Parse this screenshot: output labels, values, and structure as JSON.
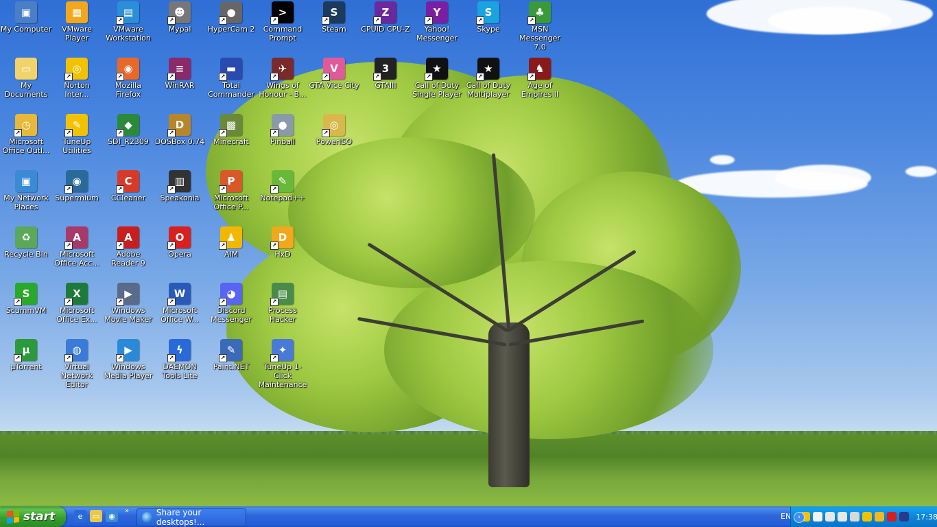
{
  "desktop": {
    "icons": [
      {
        "label": "My Computer",
        "icon": "computer-icon",
        "color": "#4a7fc6",
        "glyph": "▣"
      },
      {
        "label": "VMware Player",
        "icon": "vmware-icon",
        "color": "#f2a71c",
        "glyph": "▦"
      },
      {
        "label": "VMware Workstation",
        "icon": "vmware-workstation-icon",
        "color": "#2a8fd6",
        "glyph": "▤"
      },
      {
        "label": "Mypal",
        "icon": "mypal-icon",
        "color": "#777777",
        "glyph": "☻"
      },
      {
        "label": "HyperCam 2",
        "icon": "hypercam-icon",
        "color": "#666666",
        "glyph": "●"
      },
      {
        "label": "Command Prompt",
        "icon": "cmd-icon",
        "color": "#000000",
        "glyph": ">"
      },
      {
        "label": "Steam",
        "icon": "steam-icon",
        "color": "#1b3a5c",
        "glyph": "S"
      },
      {
        "label": "CPUID CPU-Z",
        "icon": "cpuz-icon",
        "color": "#6a2a9e",
        "glyph": "Z"
      },
      {
        "label": "Yahoo! Messenger",
        "icon": "yahoo-icon",
        "color": "#7a1fa2",
        "glyph": "Y"
      },
      {
        "label": "Skype",
        "icon": "skype-icon",
        "color": "#1aa3e0",
        "glyph": "S"
      },
      {
        "label": "MSN Messenger 7.0",
        "icon": "msn-icon",
        "color": "#3a9a3a",
        "glyph": "♣"
      },
      {
        "label": "My Documents",
        "icon": "documents-icon",
        "color": "#f2d36a",
        "glyph": "▭"
      },
      {
        "label": "Norton Inter...",
        "icon": "norton-icon",
        "color": "#f2c200",
        "glyph": "◎"
      },
      {
        "label": "Mozilla Firefox",
        "icon": "firefox-icon",
        "color": "#e8682a",
        "glyph": "◉"
      },
      {
        "label": "WinRAR",
        "icon": "winrar-icon",
        "color": "#8a2a6a",
        "glyph": "≡"
      },
      {
        "label": "Total Commander",
        "icon": "total-commander-icon",
        "color": "#2a4ab0",
        "glyph": "▬"
      },
      {
        "label": "Wings of Honour - B...",
        "icon": "wings-of-honour-icon",
        "color": "#7a2a2a",
        "glyph": "✈"
      },
      {
        "label": "GTA Vice City",
        "icon": "gta-vice-city-icon",
        "color": "#e05a9a",
        "glyph": "V"
      },
      {
        "label": "GTAIII",
        "icon": "gta3-icon",
        "color": "#222222",
        "glyph": "3"
      },
      {
        "label": "Call of Duty Single Player",
        "icon": "cod-sp-icon",
        "color": "#111111",
        "glyph": "★"
      },
      {
        "label": "Call of Duty Multiplayer",
        "icon": "cod-mp-icon",
        "color": "#111111",
        "glyph": "★"
      },
      {
        "label": "Age of Empires II",
        "icon": "aoe2-icon",
        "color": "#8a1a1a",
        "glyph": "♞"
      },
      {
        "label": "Microsoft Office Outl...",
        "icon": "outlook-icon",
        "color": "#e8b83a",
        "glyph": "◷"
      },
      {
        "label": "TuneUp Utilities",
        "icon": "tuneup-icon",
        "color": "#f2c200",
        "glyph": "✎"
      },
      {
        "label": "SDI_R2309",
        "icon": "sdi-icon",
        "color": "#2a8a3a",
        "glyph": "◆"
      },
      {
        "label": "DOSBox 0.74",
        "icon": "dosbox-icon",
        "color": "#b8862a",
        "glyph": "D"
      },
      {
        "label": "Minecraft",
        "icon": "minecraft-icon",
        "color": "#6a8a3a",
        "glyph": "▩"
      },
      {
        "label": "Pinball",
        "icon": "pinball-icon",
        "color": "#8a9aaa",
        "glyph": "●"
      },
      {
        "label": "PowerISO",
        "icon": "poweriso-icon",
        "color": "#d8b84a",
        "glyph": "◎"
      },
      {
        "label": "My Network Places",
        "icon": "network-places-icon",
        "color": "#3a8ad6",
        "glyph": "▣"
      },
      {
        "label": "Supermium",
        "icon": "supermium-icon",
        "color": "#2a6a9a",
        "glyph": "◉"
      },
      {
        "label": "CCleaner",
        "icon": "ccleaner-icon",
        "color": "#d83a2a",
        "glyph": "C"
      },
      {
        "label": "Speakonia",
        "icon": "speakonia-icon",
        "color": "#333333",
        "glyph": "▥"
      },
      {
        "label": "Microsoft Office P...",
        "icon": "powerpoint-icon",
        "color": "#d8582a",
        "glyph": "P"
      },
      {
        "label": "Notepad++",
        "icon": "notepadpp-icon",
        "color": "#6ab83a",
        "glyph": "✎"
      },
      {
        "label": "Recycle Bin",
        "icon": "recycle-bin-icon",
        "color": "#5aa85a",
        "glyph": "♻"
      },
      {
        "label": "Microsoft Office Acc...",
        "icon": "access-icon",
        "color": "#a83a6a",
        "glyph": "A"
      },
      {
        "label": "Adobe Reader 9",
        "icon": "adobe-reader-icon",
        "color": "#c81e1e",
        "glyph": "A"
      },
      {
        "label": "Opera",
        "icon": "opera-icon",
        "color": "#d8201e",
        "glyph": "O"
      },
      {
        "label": "AIM",
        "icon": "aim-icon",
        "color": "#f2b800",
        "glyph": "♟"
      },
      {
        "label": "HxD",
        "icon": "hxd-icon",
        "color": "#f2a81c",
        "glyph": "D"
      },
      {
        "label": "ScummVM",
        "icon": "scummvm-icon",
        "color": "#2aa82a",
        "glyph": "S"
      },
      {
        "label": "Microsoft Office Ex...",
        "icon": "excel-icon",
        "color": "#1e7a3a",
        "glyph": "X"
      },
      {
        "label": "Windows Movie Maker",
        "icon": "movie-maker-icon",
        "color": "#5a6a8a",
        "glyph": "▶"
      },
      {
        "label": "Microsoft Office W...",
        "icon": "word-icon",
        "color": "#2a5ab8",
        "glyph": "W"
      },
      {
        "label": "Discord Messenger",
        "icon": "discord-icon",
        "color": "#5865f2",
        "glyph": "◕"
      },
      {
        "label": "Process Hacker",
        "icon": "process-hacker-icon",
        "color": "#4a8a4a",
        "glyph": "▤"
      },
      {
        "label": "µTorrent",
        "icon": "utorrent-icon",
        "color": "#2a9a3a",
        "glyph": "µ"
      },
      {
        "label": "Virtual Network Editor",
        "icon": "vnet-editor-icon",
        "color": "#3a7ad8",
        "glyph": "◍"
      },
      {
        "label": "Windows Media Player",
        "icon": "media-player-icon",
        "color": "#2a8ad8",
        "glyph": "▶"
      },
      {
        "label": "DAEMON Tools Lite",
        "icon": "daemon-tools-icon",
        "color": "#2a6ad8",
        "glyph": "ϟ"
      },
      {
        "label": "Paint.NET",
        "icon": "paintnet-icon",
        "color": "#3a6ab8",
        "glyph": "✎"
      },
      {
        "label": "TuneUp 1-Click Maintenance",
        "icon": "tuneup-1click-icon",
        "color": "#4a7ad8",
        "glyph": "✦"
      }
    ]
  },
  "taskbar": {
    "start_label": "start",
    "quick_launch": [
      {
        "icon": "internet-explorer-icon",
        "color": "#2a6ad8",
        "glyph": "e"
      },
      {
        "icon": "folder-icon",
        "color": "#e8c84a",
        "glyph": "▭"
      },
      {
        "icon": "browser-icon",
        "color": "#3a8ad8",
        "glyph": "◉"
      }
    ],
    "quick_launch_more": "»",
    "task_item_label": "Share your desktops!...",
    "language": "EN",
    "collapse": "‹",
    "tray_icons": [
      {
        "icon": "security-shield-icon",
        "color": "#f2c200"
      },
      {
        "icon": "notes-icon",
        "color": "#f2f2f2"
      },
      {
        "icon": "search-icon",
        "color": "#e8e8e8"
      },
      {
        "icon": "speaker-icon",
        "color": "#e8e8e8"
      },
      {
        "icon": "network-icon",
        "color": "#d8d8d8"
      },
      {
        "icon": "user-icon",
        "color": "#f2c200"
      },
      {
        "icon": "globe-icon",
        "color": "#f2b81e"
      },
      {
        "icon": "antivirus-icon",
        "color": "#d81e1e"
      },
      {
        "icon": "display-icon",
        "color": "#2a3a8a"
      }
    ],
    "clock": "17:38"
  }
}
